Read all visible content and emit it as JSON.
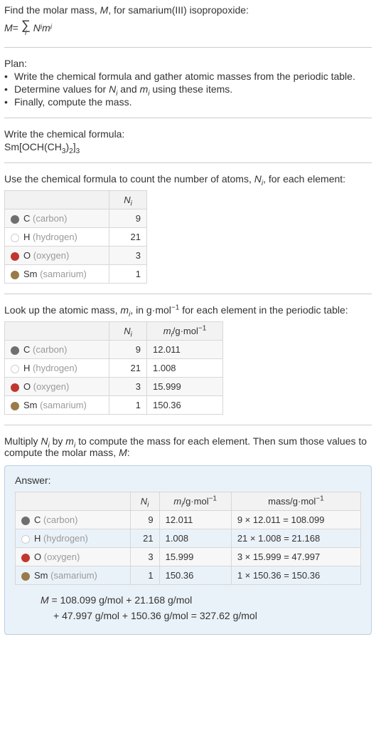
{
  "intro": {
    "line1_a": "Find the molar mass, ",
    "line1_b": ", for samarium(III) isopropoxide:",
    "eq_lhs": "M",
    "eq_eq": " = ",
    "eq_sum_sub": "i",
    "eq_rhs_a": "N",
    "eq_rhs_b": "m"
  },
  "plan": {
    "title": "Plan:",
    "b1a": "Write the chemical formula and gather atomic masses from the periodic table.",
    "b2a": "Determine values for ",
    "b2b": " and ",
    "b2c": " using these items.",
    "b3a": "Finally, compute the mass.",
    "bullet": "•"
  },
  "chem": {
    "title": "Write the chemical formula:",
    "p1": "Sm[OCH(CH",
    "s1": "3",
    "p2": ")",
    "s2": "2",
    "p3": "]",
    "s3": "3"
  },
  "count": {
    "text_a": "Use the chemical formula to count the number of atoms, ",
    "text_b": ", for each element:",
    "h_ni": "N",
    "h_ni_sub": "i"
  },
  "elements": [
    {
      "sym": "C",
      "full": "(carbon)",
      "color": "#6f6f6f",
      "fill": true
    },
    {
      "sym": "H",
      "full": "(hydrogen)",
      "color": "#cfcfcf",
      "fill": false
    },
    {
      "sym": "O",
      "full": "(oxygen)",
      "color": "#c1372f",
      "fill": true
    },
    {
      "sym": "Sm",
      "full": "(samarium)",
      "color": "#9a7a49",
      "fill": true
    }
  ],
  "table1_values": [
    "9",
    "21",
    "3",
    "1"
  ],
  "lookup": {
    "text_a": "Look up the atomic mass, ",
    "text_b": ", in g·mol",
    "text_c": " for each element in the periodic table:",
    "h_mi_a": "m",
    "h_mi_sub": "i",
    "h_mi_unit_a": "/g·mol",
    "h_mi_unit_sup": "−1"
  },
  "table2_mi": [
    "12.011",
    "1.008",
    "15.999",
    "150.36"
  ],
  "multiply": {
    "a": "Multiply ",
    "b": " by ",
    "c": " to compute the mass for each element. Then sum those values to compute the molar mass, ",
    "d": ":"
  },
  "answer": {
    "label": "Answer:",
    "h_mass_a": "mass/g·mol",
    "h_mass_sup": "−1",
    "rows": [
      "9 × 12.011 = 108.099",
      "21 × 1.008 = 21.168",
      "3 × 15.999 = 47.997",
      "1 × 150.36 = 150.36"
    ],
    "final1_a": "M",
    "final1_b": " = 108.099 g/mol + 21.168 g/mol",
    "final2": "+ 47.997 g/mol + 150.36 g/mol = 327.62 g/mol"
  }
}
